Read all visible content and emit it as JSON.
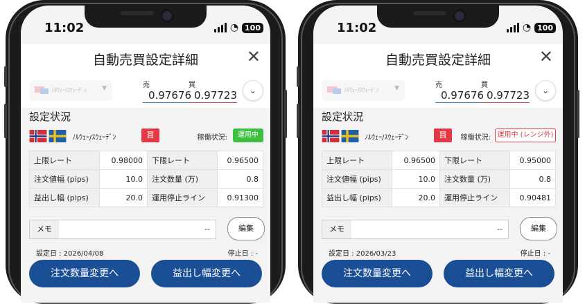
{
  "screens": [
    {
      "time": "11:02",
      "battery": "100",
      "title": "自動売買設定詳細",
      "pair_select": "ﾉﾙｳｪｰ/ｽｳｪｰﾃﾞﾝ",
      "sell_label": "売",
      "buy_label": "買",
      "sell_rate": "0.97676",
      "buy_rate": "0.97723",
      "section_title": "設定状況",
      "pair_name": "ﾉﾙｳｪｰ/ｽｳｪｰﾃﾞﾝ",
      "side": "買",
      "op_label": "稼働状況:",
      "op_status": "運用中",
      "params": {
        "upper_label": "上限レート",
        "upper_value": "0.98000",
        "lower_label": "下限レート",
        "lower_value": "0.96500",
        "width_label": "注文値幅 (pips)",
        "width_value": "10.0",
        "qty_label": "注文数量 (万)",
        "qty_value": "0.8",
        "profit_label": "益出し幅 (pips)",
        "profit_value": "20.0",
        "stop_label": "運用停止ライン",
        "stop_value": "0.91300"
      },
      "memo_label": "メモ",
      "memo_value": "--",
      "edit_label": "編集",
      "set_date": "設定日 : 2026/04/08",
      "stop_date": "停止日 : -",
      "btn_qty": "注文数量変更へ",
      "btn_profit": "益出し幅変更へ"
    },
    {
      "time": "11:02",
      "battery": "100",
      "title": "自動売買設定詳細",
      "pair_select": "ﾉﾙｳｪｰ/ｽｳｪｰﾃﾞﾝ",
      "sell_label": "売",
      "buy_label": "買",
      "sell_rate": "0.97676",
      "buy_rate": "0.97723",
      "section_title": "設定状況",
      "pair_name": "ﾉﾙｳｪｰ/ｽｳｪｰﾃﾞﾝ",
      "side": "買",
      "op_label": "稼働状況:",
      "op_status": "運用中 (レンジ外)",
      "params": {
        "upper_label": "上限レート",
        "upper_value": "0.96500",
        "lower_label": "下限レート",
        "lower_value": "0.95000",
        "width_label": "注文値幅 (pips)",
        "width_value": "10.0",
        "qty_label": "注文数量 (万)",
        "qty_value": "0.8",
        "profit_label": "益出し幅 (pips)",
        "profit_value": "20.0",
        "stop_label": "運用停止ライン",
        "stop_value": "0.90481"
      },
      "memo_label": "メモ",
      "memo_value": "--",
      "edit_label": "編集",
      "set_date": "設定日 : 2026/03/23",
      "stop_date": "停止日 : -",
      "btn_qty": "注文数量変更へ",
      "btn_profit": "益出し幅変更へ"
    }
  ]
}
